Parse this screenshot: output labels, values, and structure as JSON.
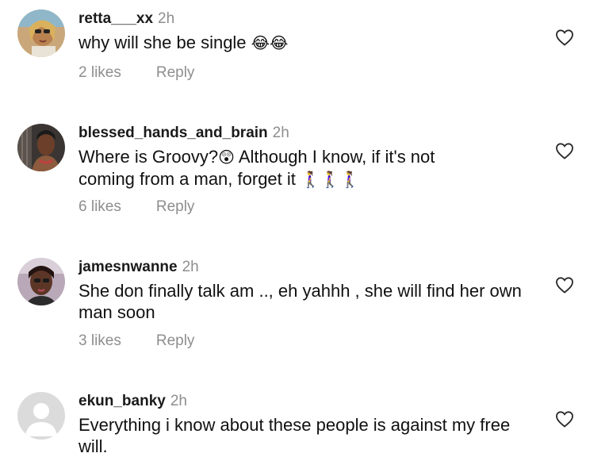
{
  "comments": [
    {
      "username": "retta___xx",
      "time": "2h",
      "text": "why will she be single",
      "emoji": "😂😂",
      "likes": "2 likes",
      "reply": "Reply",
      "avatar_icon": "profile-photo-icon",
      "heart_icon": "heart-outline-icon"
    },
    {
      "username": "blessed_hands_and_brain",
      "time": "2h",
      "text_line1": "Where is Groovy?",
      "emoji1": "😲",
      "text_line1b": " Although I know, if it's not",
      "text_line2": "coming from a man, forget it",
      "emoji2": "🚶‍♀️🚶‍♀️🚶‍♀️",
      "likes": "6 likes",
      "reply": "Reply",
      "avatar_icon": "profile-photo-icon",
      "heart_icon": "heart-outline-icon"
    },
    {
      "username": "jamesnwanne",
      "time": "2h",
      "text": "She don finally talk am .., eh yahhh , she will find her own man soon",
      "likes": "3 likes",
      "reply": "Reply",
      "avatar_icon": "profile-photo-icon",
      "heart_icon": "heart-outline-icon"
    },
    {
      "username": "ekun_banky",
      "time": "2h",
      "text": "Everything i know about these people is against my free will.",
      "avatar_icon": "default-avatar-icon",
      "heart_icon": "heart-outline-icon"
    }
  ],
  "colors": {
    "muted": "#8e8e8e",
    "text": "#111111"
  }
}
